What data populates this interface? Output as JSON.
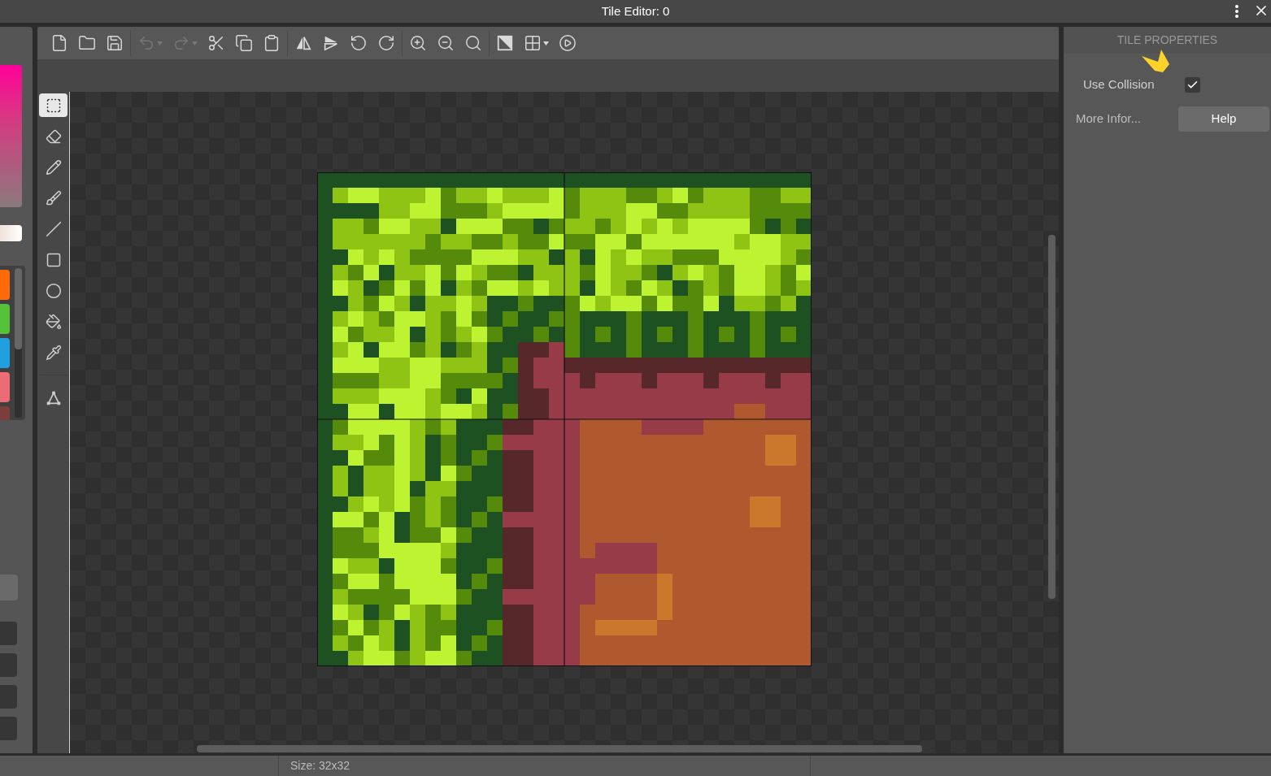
{
  "window": {
    "title": "Tile Editor: 0"
  },
  "palette": {
    "swatches": [
      {
        "color": "#ff6a0a"
      },
      {
        "color": "#55c33a"
      },
      {
        "color": "#21a0e0"
      },
      {
        "color": "#eb6b77"
      },
      {
        "color": "#7a3f3a"
      }
    ]
  },
  "toolbar": [
    [
      {
        "kind": "new",
        "disabled": false,
        "menu": false
      },
      {
        "kind": "open",
        "disabled": false,
        "menu": false
      },
      {
        "kind": "save",
        "disabled": false,
        "menu": false
      }
    ],
    [
      {
        "kind": "undo",
        "disabled": true,
        "menu": true
      },
      {
        "kind": "redo",
        "disabled": true,
        "menu": true
      },
      {
        "kind": "cut",
        "disabled": false,
        "menu": false
      },
      {
        "kind": "copy",
        "disabled": false,
        "menu": false
      },
      {
        "kind": "paste",
        "disabled": false,
        "menu": false
      }
    ],
    [
      {
        "kind": "flip-h",
        "disabled": false,
        "menu": false
      },
      {
        "kind": "flip-v",
        "disabled": false,
        "menu": false
      },
      {
        "kind": "rotate-ccw",
        "disabled": false,
        "menu": false
      },
      {
        "kind": "rotate-cw",
        "disabled": false,
        "menu": false
      }
    ],
    [
      {
        "kind": "zoom-in",
        "disabled": false,
        "menu": false
      },
      {
        "kind": "zoom-out",
        "disabled": false,
        "menu": false
      },
      {
        "kind": "zoom-fit",
        "disabled": false,
        "menu": false
      }
    ],
    [
      {
        "kind": "background",
        "disabled": false,
        "menu": false
      },
      {
        "kind": "grid",
        "disabled": false,
        "menu": true
      },
      {
        "kind": "play",
        "disabled": false,
        "menu": false
      }
    ]
  ],
  "tools": [
    {
      "kind": "select",
      "selected": true
    },
    {
      "kind": "eraser",
      "selected": false
    },
    {
      "kind": "pencil",
      "selected": false
    },
    {
      "kind": "brush",
      "selected": false
    },
    {
      "kind": "line",
      "selected": false
    },
    {
      "kind": "rectangle",
      "selected": false
    },
    {
      "kind": "ellipse",
      "selected": false
    },
    {
      "kind": "fill",
      "selected": false
    },
    {
      "kind": "eyedropper",
      "selected": false
    },
    {
      "kind": "nodes",
      "selected": false
    }
  ],
  "properties": {
    "header": "TILE PROPERTIES",
    "use_collision": {
      "label": "Use Collision",
      "checked": true
    },
    "more_info": {
      "label": "More Infor...",
      "button": "Help"
    }
  },
  "status_bar": {
    "size": "Size: 32x32"
  }
}
